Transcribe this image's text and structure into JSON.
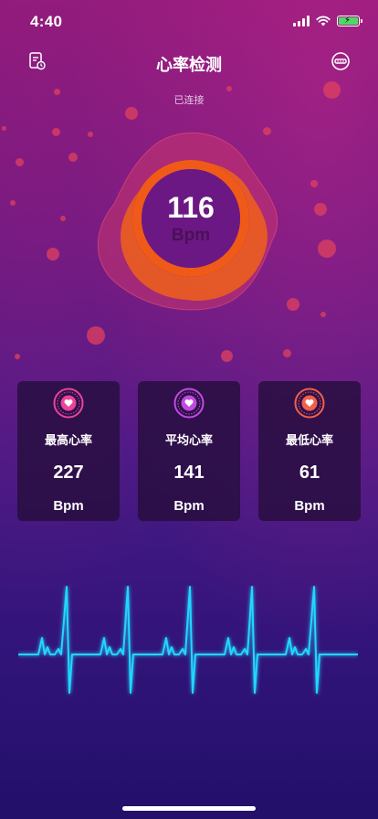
{
  "status_bar": {
    "time": "4:40"
  },
  "nav": {
    "title": "心率检测",
    "left_icon": "history-record-icon",
    "right_icon": "device-icon"
  },
  "connection_status": "已连接",
  "heart_rate": {
    "value": "116",
    "unit": "Bpm"
  },
  "stats": [
    {
      "label": "最高心率",
      "value": "227",
      "unit": "Bpm",
      "icon": "heart-max-icon",
      "color": "#e8449a"
    },
    {
      "label": "平均心率",
      "value": "141",
      "unit": "Bpm",
      "icon": "heart-avg-icon",
      "color": "#c24ae0"
    },
    {
      "label": "最低心率",
      "value": "61",
      "unit": "Bpm",
      "icon": "heart-min-icon",
      "color": "#f0604a"
    }
  ],
  "colors": {
    "accent_orange": "#f05a18",
    "ecg_line": "#22d6ff",
    "dot_red": "#e0415e"
  }
}
